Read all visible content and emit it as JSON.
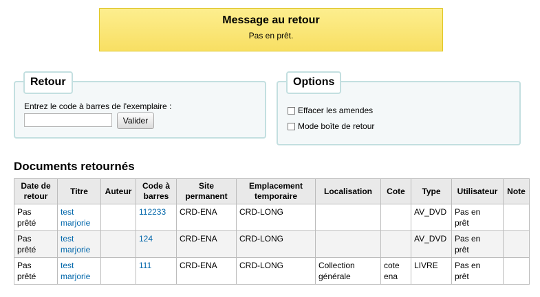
{
  "message": {
    "title": "Message au retour",
    "text": "Pas en prêt."
  },
  "checkin": {
    "legend": "Retour",
    "label": "Entrez le code à barres de l'exemplaire :",
    "barcode_value": "",
    "submit_label": "Valider"
  },
  "options": {
    "legend": "Options",
    "items": [
      {
        "label": "Effacer les amendes",
        "checked": false
      },
      {
        "label": "Mode boîte de retour",
        "checked": false
      }
    ]
  },
  "returned": {
    "title": "Documents retournés",
    "columns": {
      "date": [
        "Date de",
        "retour"
      ],
      "title": "Titre",
      "author": "Auteur",
      "barcode": [
        "Code à",
        "barres"
      ],
      "site": [
        "Site",
        "permanent"
      ],
      "location": [
        "Emplacement",
        "temporaire"
      ],
      "localisation": "Localisation",
      "callnumber": "Cote",
      "type": "Type",
      "user": "Utilisateur",
      "note": "Note"
    },
    "rows": [
      {
        "date": [
          "Pas",
          "prêté"
        ],
        "title": [
          "test",
          "marjorie"
        ],
        "author": "",
        "barcode": "112233",
        "site": "CRD-ENA",
        "location": "CRD-LONG",
        "localisation": [
          "",
          ""
        ],
        "callnumber": [
          "",
          ""
        ],
        "type": "AV_DVD",
        "user": [
          "Pas en",
          "prêt"
        ],
        "note": ""
      },
      {
        "date": [
          "Pas",
          "prêté"
        ],
        "title": [
          "test",
          "marjorie"
        ],
        "author": "",
        "barcode": "124",
        "site": "CRD-ENA",
        "location": "CRD-LONG",
        "localisation": [
          "",
          ""
        ],
        "callnumber": [
          "",
          ""
        ],
        "type": "AV_DVD",
        "user": [
          "Pas en",
          "prêt"
        ],
        "note": ""
      },
      {
        "date": [
          "Pas",
          "prêté"
        ],
        "title": [
          "test",
          "marjorie"
        ],
        "author": "",
        "barcode": "111",
        "site": "CRD-ENA",
        "location": "CRD-LONG",
        "localisation": [
          "Collection",
          "générale"
        ],
        "callnumber": [
          "cote",
          "ena"
        ],
        "type": "LIVRE",
        "user": [
          "Pas en",
          "prêt"
        ],
        "note": ""
      }
    ]
  }
}
